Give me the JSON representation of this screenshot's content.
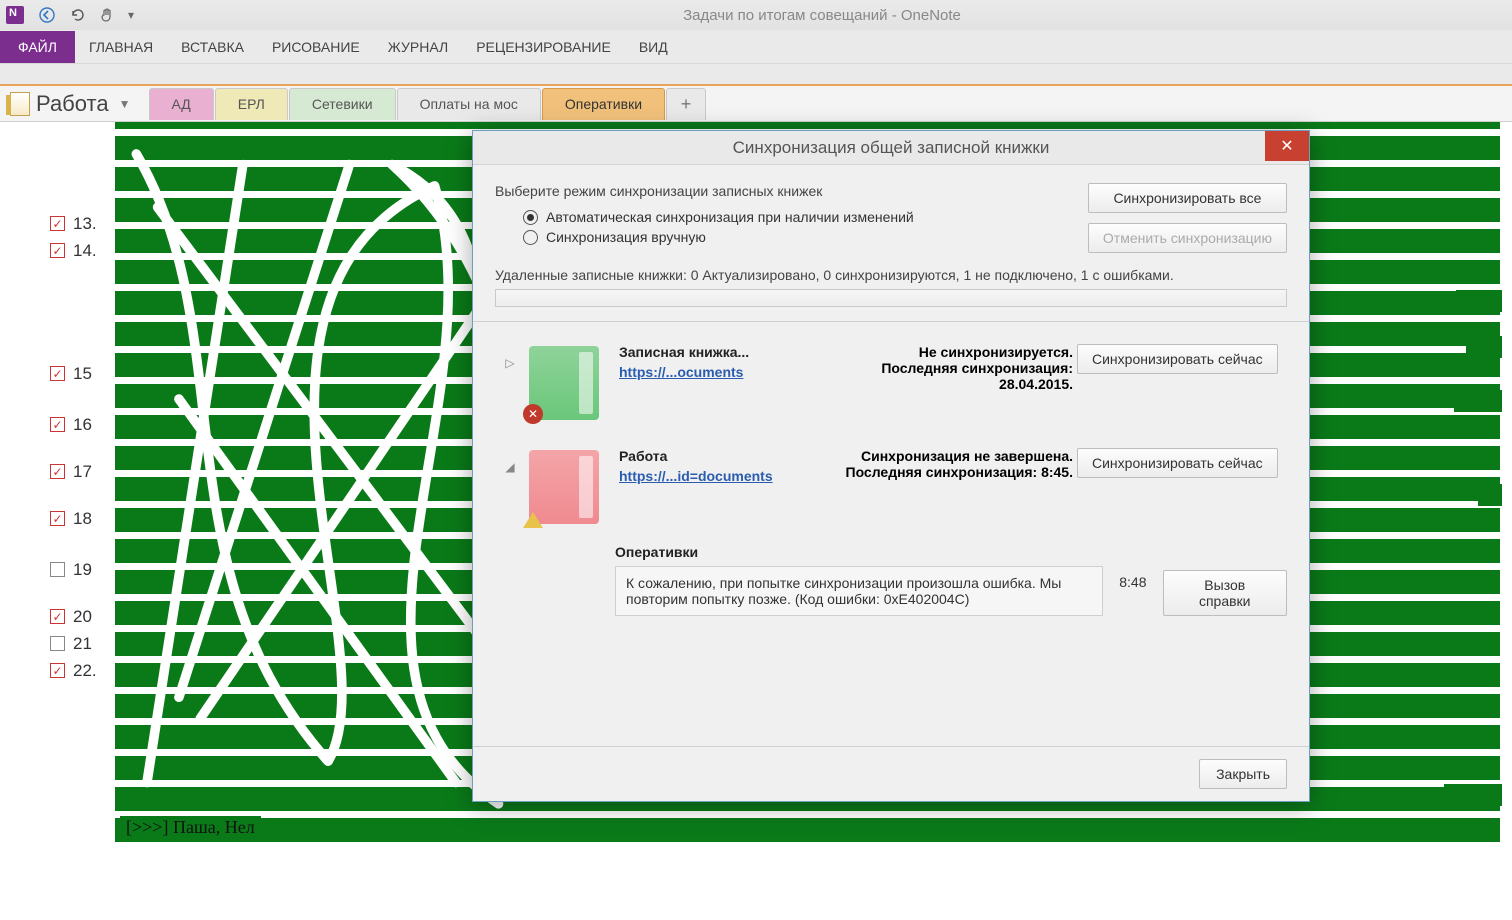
{
  "app": {
    "window_title": "Задачи по итогам совещаний - OneNote"
  },
  "quick_access": {
    "back": "←",
    "undo": "↶",
    "touch": "✋",
    "more": "▾"
  },
  "ribbon": {
    "file": "ФАЙЛ",
    "tabs": [
      "ГЛАВНАЯ",
      "ВСТАВКА",
      "РИСОВАНИЕ",
      "ЖУРНАЛ",
      "РЕЦЕНЗИРОВАНИЕ",
      "ВИД"
    ]
  },
  "notebook": {
    "name": "Работа"
  },
  "sections": {
    "items": [
      {
        "label": "АД",
        "color": "pink"
      },
      {
        "label": "ЕРЛ",
        "color": "yellow"
      },
      {
        "label": "Сетевики",
        "color": "green"
      },
      {
        "label": "Оплаты на мос",
        "color": "plain"
      },
      {
        "label": "Оперативки",
        "color": "orange"
      }
    ],
    "add": "+"
  },
  "page": {
    "lines": [
      {
        "num": "13.",
        "checked": true
      },
      {
        "num": "14.",
        "checked": true
      },
      {
        "num": "15",
        "checked": true
      },
      {
        "num": "16",
        "checked": true
      },
      {
        "num": "17",
        "checked": true
      },
      {
        "num": "18",
        "checked": true
      },
      {
        "num": "19",
        "checked": false
      },
      {
        "num": "20",
        "checked": true
      },
      {
        "num": "21",
        "checked": false
      },
      {
        "num": "22.",
        "checked": true
      }
    ],
    "visible_fragment": "[>>>] Паша, Нел"
  },
  "dialog": {
    "title": "Синхронизация общей записной книжки",
    "mode_caption": "Выберите режим синхронизации записных книжек",
    "radio_auto": "Автоматическая синхронизация при наличии изменений",
    "radio_manual": "Синхронизация вручную",
    "btn_sync_all": "Синхронизировать все",
    "btn_cancel_sync": "Отменить синхронизацию",
    "remote_line": "Удаленные записные книжки: 0 Актуализировано, 0 синхронизируются, 1 не подключено, 1 с ошибками.",
    "notebooks": [
      {
        "tree": "▷",
        "thumb": "green",
        "badge": "err",
        "name": "Записная книжка...",
        "link": "https://...ocuments",
        "status1": "Не синхронизируется.",
        "status2": "Последняя синхронизация: 28.04.2015.",
        "btn": "Синхронизировать сейчас"
      },
      {
        "tree": "◢",
        "thumb": "pink",
        "badge": "warn",
        "name": "Работа",
        "link": "https://...id=documents",
        "status1": "Синхронизация не завершена.",
        "status2": "Последняя синхронизация: 8:45.",
        "btn": "Синхронизировать сейчас"
      }
    ],
    "sub": {
      "section": "Оперативки",
      "message": "К сожалению, при попытке синхронизации произошла ошибка. Мы повторим попытку позже. (Код ошибки: 0xE402004C)",
      "time": "8:48",
      "help_btn": "Вызов справки"
    },
    "close_btn": "Закрыть"
  }
}
